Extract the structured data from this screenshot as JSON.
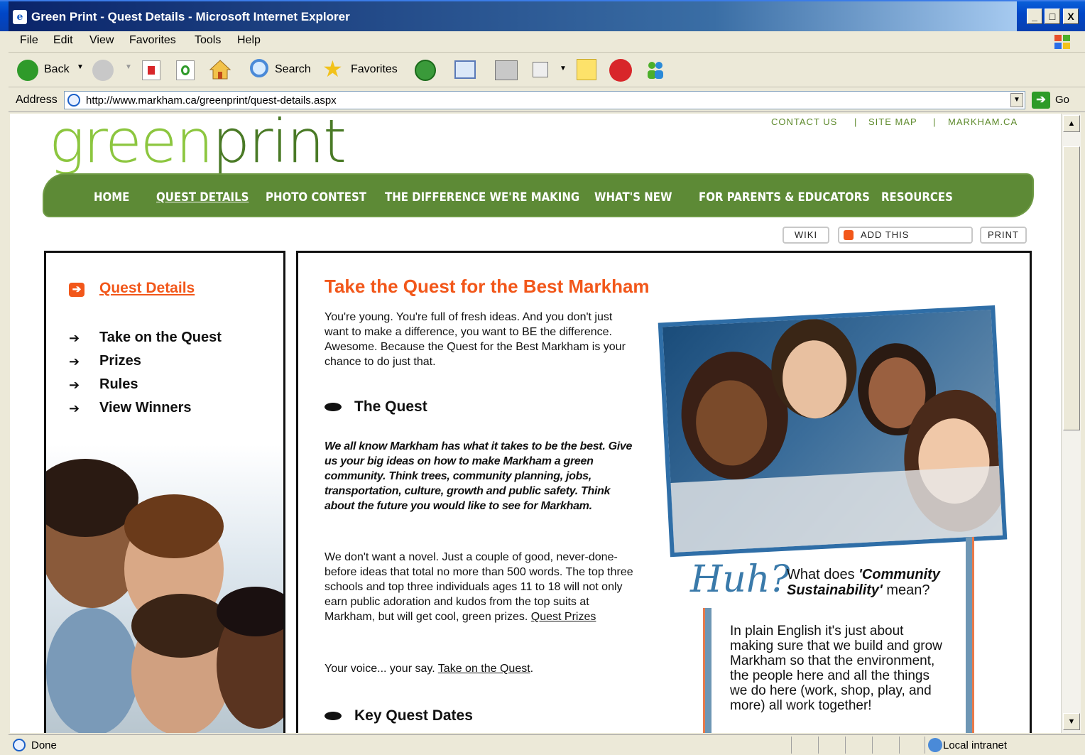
{
  "window": {
    "title": "Green Print - Quest Details - Microsoft Internet Explorer",
    "min": "_",
    "max": "□",
    "close": "X"
  },
  "menu": [
    "File",
    "Edit",
    "View",
    "Favorites",
    "Tools",
    "Help"
  ],
  "toolbar": {
    "back": "Back",
    "search": "Search",
    "favorites": "Favorites"
  },
  "address": {
    "label": "Address",
    "url": "http://www.markham.ca/greenprint/quest-details.aspx",
    "go": "Go"
  },
  "page": {
    "logo_part1": "green",
    "logo_part2": "print",
    "top_links": [
      "CONTACT US",
      "|",
      "SITE MAP",
      "|",
      "MARKHAM.CA"
    ],
    "nav": [
      "HOME",
      "QUEST DETAILS",
      "PHOTO CONTEST",
      "THE DIFFERENCE WE'RE MAKING",
      "WHAT'S NEW",
      "FOR PARENTS & EDUCATORS",
      "RESOURCES"
    ],
    "tools": {
      "wiki": "WIKI",
      "addthis": "ADD THIS",
      "print": "PRINT"
    },
    "sidebar": {
      "heading": "Quest Details",
      "items": [
        "Take on the Quest",
        "Prizes",
        "Rules",
        "View Winners"
      ]
    },
    "main": {
      "title": "Take the Quest for the Best Markham",
      "intro": "You're young. You're full of fresh ideas. And you don't just want to make a difference, you want to BE the difference. Awesome. Because the Quest for the Best Markham is your chance to do just that.",
      "quest_heading": "The Quest",
      "quest_bold": "We all know Markham has what it takes to be the best. Give us your big ideas on how to make Markham a green community. Think trees, community planning, jobs, transportation, culture, growth and public safety. Think about the future you would like to see for Markham.",
      "novel_text": "We don't want a novel. Just a couple of good, never-done-before ideas that total no more than 500 words. The top three schools and top three individuals ages 11 to 18 will not only earn public adoration and kudos from the top suits at Markham, but will get cool, green prizes. ",
      "novel_link": "Quest Prizes",
      "voice_text": "Your voice... your say. ",
      "voice_link": "Take on the Quest",
      "voice_end": ".",
      "dates_heading": "Key Quest Dates",
      "huh": "Huh?",
      "huh_q1": "What does ",
      "huh_q_bold": "'Community Sustainability'",
      "huh_q2": " mean?",
      "note": "In plain English it's just about making sure that we build and grow Markham so that the environment, the people here and all the things we do here (work, shop, play, and more) all work together!"
    }
  },
  "status": {
    "text": "Done",
    "zone": "Local intranet"
  }
}
